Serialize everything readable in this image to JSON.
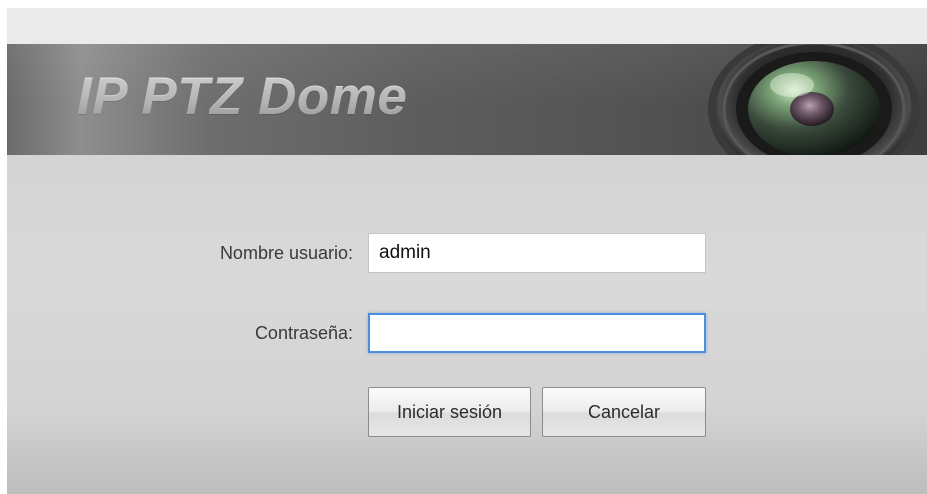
{
  "header": {
    "title": "IP PTZ Dome",
    "lens_icon": "camera-lens-icon"
  },
  "login_form": {
    "username_label": "Nombre usuario:",
    "username_value": "admin",
    "username_placeholder": "",
    "password_label": "Contraseña:",
    "password_value": "",
    "password_placeholder": "",
    "login_button": "Iniciar sesión",
    "cancel_button": "Cancelar"
  },
  "colors": {
    "banner_dark": "#3e3e3e",
    "body_gray": "#d9d9d9",
    "focus_blue": "#4b8edc"
  }
}
